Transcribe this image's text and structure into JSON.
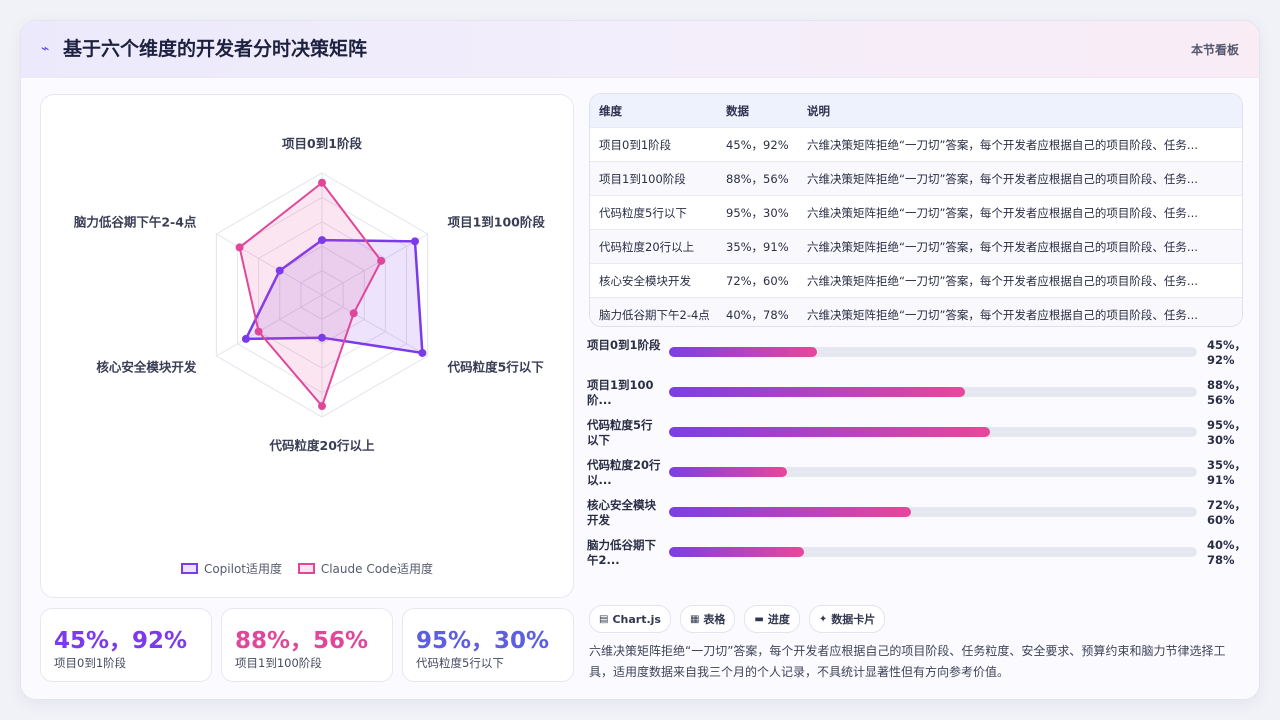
{
  "header": {
    "icon": "spark-icon",
    "title": "基于六个维度的开发者分时决策矩阵",
    "right_label": "本节看板"
  },
  "colors": {
    "copilot": "#7c3aed",
    "claude": "#e0479a"
  },
  "chart_data": {
    "type": "radar",
    "axes": [
      "项目0到1阶段",
      "项目1到100阶段",
      "代码粒度5行以下",
      "代码粒度20行以上",
      "核心安全模块开发",
      "脑力低谷期下午2-4点"
    ],
    "series": [
      {
        "name": "Copilot适用度",
        "values": [
          45,
          88,
          95,
          35,
          72,
          40
        ]
      },
      {
        "name": "Claude Code适用度",
        "values": [
          92,
          56,
          30,
          91,
          60,
          78
        ]
      }
    ],
    "range": [
      0,
      100
    ],
    "grid_levels": 5
  },
  "legend": {
    "copilot": "Copilot适用度",
    "claude": "Claude Code适用度"
  },
  "stats": [
    {
      "value": "45%，92%",
      "label": "项目0到1阶段"
    },
    {
      "value": "88%，56%",
      "label": "项目1到100阶段"
    },
    {
      "value": "95%，30%",
      "label": "代码粒度5行以下"
    }
  ],
  "table": {
    "headers": [
      "维度",
      "数据",
      "说明"
    ],
    "rows": [
      [
        "项目0到1阶段",
        "45%，92%",
        "六维决策矩阵拒绝“一刀切”答案，每个开发者应根据自己的项目阶段、任务..."
      ],
      [
        "项目1到100阶段",
        "88%，56%",
        "六维决策矩阵拒绝“一刀切”答案，每个开发者应根据自己的项目阶段、任务..."
      ],
      [
        "代码粒度5行以下",
        "95%，30%",
        "六维决策矩阵拒绝“一刀切”答案，每个开发者应根据自己的项目阶段、任务..."
      ],
      [
        "代码粒度20行以上",
        "35%，91%",
        "六维决策矩阵拒绝“一刀切”答案，每个开发者应根据自己的项目阶段、任务..."
      ],
      [
        "核心安全模块开发",
        "72%，60%",
        "六维决策矩阵拒绝“一刀切”答案，每个开发者应根据自己的项目阶段、任务..."
      ],
      [
        "脑力低谷期下午2-4点",
        "40%，78%",
        "六维决策矩阵拒绝“一刀切”答案，每个开发者应根据自己的项目阶段、任务..."
      ]
    ]
  },
  "bars": [
    {
      "label": "项目0到1阶段",
      "value": "45%，92%",
      "fill": 0.28
    },
    {
      "label": "项目1到100阶...",
      "value": "88%，56%",
      "fill": 0.56
    },
    {
      "label": "代码粒度5行以下",
      "value": "95%，30%",
      "fill": 0.608
    },
    {
      "label": "代码粒度20行以...",
      "value": "35%，91%",
      "fill": 0.223
    },
    {
      "label": "核心安全模块开发",
      "value": "72%，60%",
      "fill": 0.459
    },
    {
      "label": "脑力低谷期下午2...",
      "value": "40%，78%",
      "fill": 0.255
    }
  ],
  "chips": [
    {
      "icon": "grid-icon",
      "glyph": "▤",
      "label": "Chart.js"
    },
    {
      "icon": "table-icon",
      "glyph": "▦",
      "label": "表格"
    },
    {
      "icon": "progress-icon",
      "glyph": "▬",
      "label": "进度"
    },
    {
      "icon": "sparkle-icon",
      "glyph": "✦",
      "label": "数据卡片"
    }
  ],
  "description": "六维决策矩阵拒绝“一刀切”答案，每个开发者应根据自己的项目阶段、任务粒度、安全要求、预算约束和脑力节律选择工具，适用度数据来自我三个月的个人记录，不具统计显著性但有方向参考价值。"
}
